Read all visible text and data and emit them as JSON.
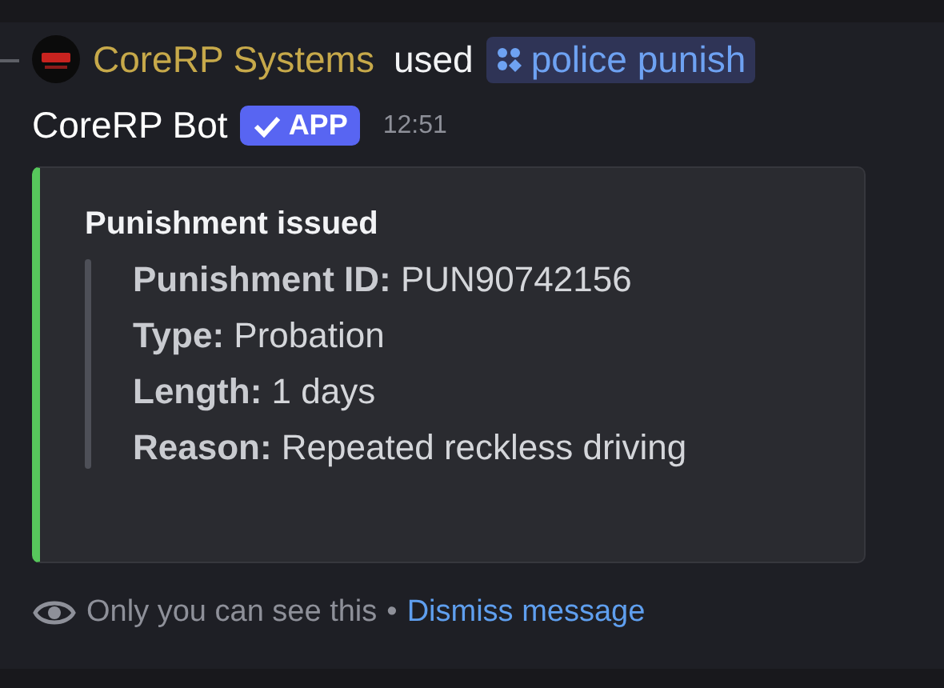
{
  "command_line": {
    "user": "CoreRP Systems",
    "verb": "used",
    "command": "police punish"
  },
  "author": {
    "name": "CoreRP Bot",
    "badge": "APP",
    "verified": true,
    "time": "12:51"
  },
  "embed": {
    "color": "#57c75c",
    "title": "Punishment issued",
    "fields": [
      {
        "label": "Punishment ID:",
        "value": "PUN90742156"
      },
      {
        "label": "Type:",
        "value": "Probation"
      },
      {
        "label": "Length:",
        "value": "1 days"
      },
      {
        "label": "Reason:",
        "value": "Repeated reckless driving"
      }
    ]
  },
  "footer": {
    "note": "Only you can see this",
    "separator": "•",
    "link": "Dismiss message"
  }
}
